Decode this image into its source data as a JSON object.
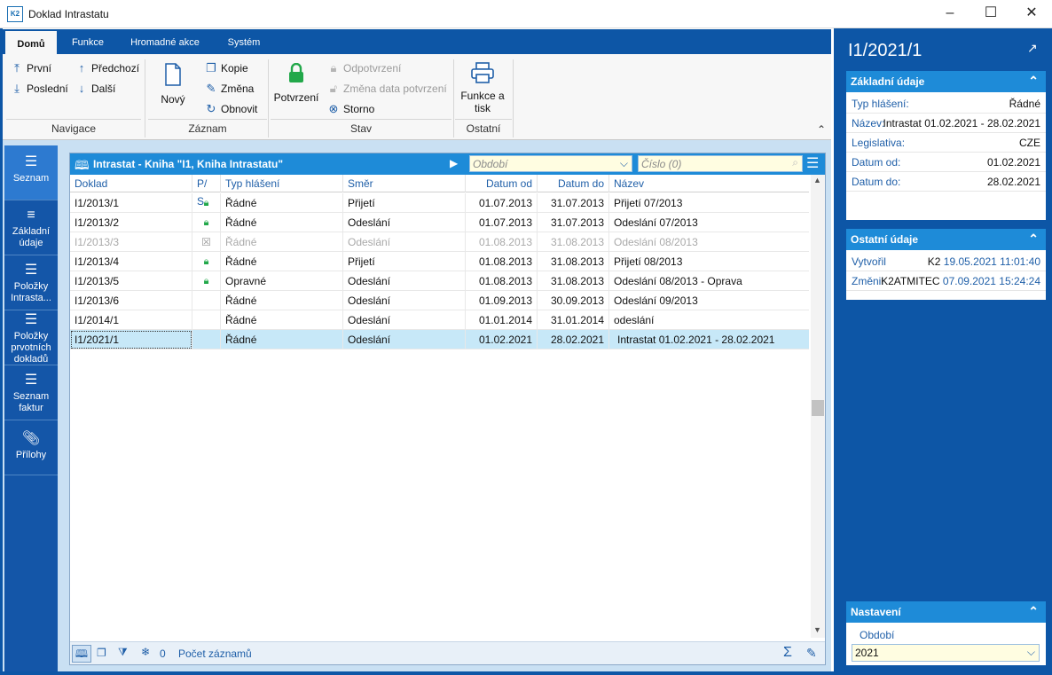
{
  "window": {
    "title": "Doklad Intrastatu",
    "logo": "K2"
  },
  "tabs": [
    "Domů",
    "Funkce",
    "Hromadné akce",
    "Systém"
  ],
  "ribbon": {
    "navigace": {
      "first": "První",
      "last": "Poslední",
      "prev": "Předchozí",
      "next": "Další",
      "group": "Navigace"
    },
    "zaznam": {
      "new": "Nový",
      "copy": "Kopie",
      "change": "Změna",
      "refresh": "Obnovit",
      "group": "Záznam"
    },
    "stav": {
      "confirm": "Potvrzení",
      "unconfirm": "Odpotvrzení",
      "change_date": "Změna data potvrzení",
      "storno": "Storno",
      "group": "Stav"
    },
    "ostatni": {
      "print_l1": "Funkce a",
      "print_l2": "tisk",
      "group": "Ostatní"
    }
  },
  "leftnav": [
    {
      "l1": "Seznam",
      "l2": "",
      "l3": ""
    },
    {
      "l1": "Základní",
      "l2": "údaje",
      "l3": ""
    },
    {
      "l1": "Položky",
      "l2": "Intrasta...",
      "l3": ""
    },
    {
      "l1": "Položky",
      "l2": "prvotních",
      "l3": "dokladů"
    },
    {
      "l1": "Seznam",
      "l2": "faktur",
      "l3": ""
    },
    {
      "l1": "Přílohy",
      "l2": "",
      "l3": ""
    }
  ],
  "grid": {
    "title": "Intrastat - Kniha \"I1, Kniha Intrastatu\"",
    "period_placeholder": "Období",
    "number_placeholder": "Číslo (0)",
    "columns": [
      "Doklad",
      "P/ S",
      "Typ hlášení",
      "Směr",
      "Datum od",
      "Datum do",
      "Název"
    ],
    "rows": [
      {
        "doklad": "I1/2013/1",
        "typ": "Řádné",
        "smer": "Přijetí",
        "od": "01.07.2013",
        "do": "31.07.2013",
        "nazev": "Přijetí 07/2013"
      },
      {
        "doklad": "I1/2013/2",
        "typ": "Řádné",
        "smer": "Odeslání",
        "od": "01.07.2013",
        "do": "31.07.2013",
        "nazev": "Odeslání 07/2013"
      },
      {
        "doklad": "I1/2013/3",
        "typ": "Řádné",
        "smer": "Odeslání",
        "od": "01.08.2013",
        "do": "31.08.2013",
        "nazev": "Odeslání 08/2013"
      },
      {
        "doklad": "I1/2013/4",
        "typ": "Řádné",
        "smer": "Přijetí",
        "od": "01.08.2013",
        "do": "31.08.2013",
        "nazev": "Přijetí 08/2013"
      },
      {
        "doklad": "I1/2013/5",
        "typ": "Opravné",
        "smer": "Odeslání",
        "od": "01.08.2013",
        "do": "31.08.2013",
        "nazev": "Odeslání 08/2013 - Oprava"
      },
      {
        "doklad": "I1/2013/6",
        "typ": "Řádné",
        "smer": "Odeslání",
        "od": "01.09.2013",
        "do": "30.09.2013",
        "nazev": "Odeslání 09/2013"
      },
      {
        "doklad": "I1/2014/1",
        "typ": "Řádné",
        "smer": "Odeslání",
        "od": "01.01.2014",
        "do": "31.01.2014",
        "nazev": "odeslání"
      },
      {
        "doklad": "I1/2021/1",
        "typ": "Řádné",
        "smer": "Odeslání",
        "od": "01.02.2021",
        "do": "28.02.2021",
        "nazev": "Intrastat 01.02.2021 - 28.02.2021"
      }
    ],
    "footer": {
      "count": "0",
      "records_label": "Počet záznamů",
      "sum": "Σ"
    }
  },
  "rightpane": {
    "doc_title": "I1/2021/1",
    "basic": {
      "header": "Základní údaje",
      "typ_label": "Typ hlášení:",
      "typ": "Řádné",
      "nazev_label": "Název:",
      "nazev": "Intrastat 01.02.2021 - 28.02.2021",
      "leg_label": "Legislativa:",
      "leg": "CZE",
      "od_label": "Datum od:",
      "od": "01.02.2021",
      "do_label": "Datum do:",
      "do": "28.02.2021"
    },
    "other": {
      "header": "Ostatní údaje",
      "created_label": "Vytvořil",
      "created_user": "K2",
      "created_date": "19.05.2021 11:01:40",
      "changed_label": "Změnil",
      "changed_user": "K2ATMITEC",
      "changed_date": "07.09.2021 15:24:24"
    },
    "settings": {
      "header": "Nastavení",
      "period_label": "Období",
      "period_value": "2021"
    }
  },
  "colors": {
    "frame": "#0d56a6",
    "header": "#1e8bd8",
    "selected": "#c7e8f8",
    "lock": "#22a84a"
  }
}
